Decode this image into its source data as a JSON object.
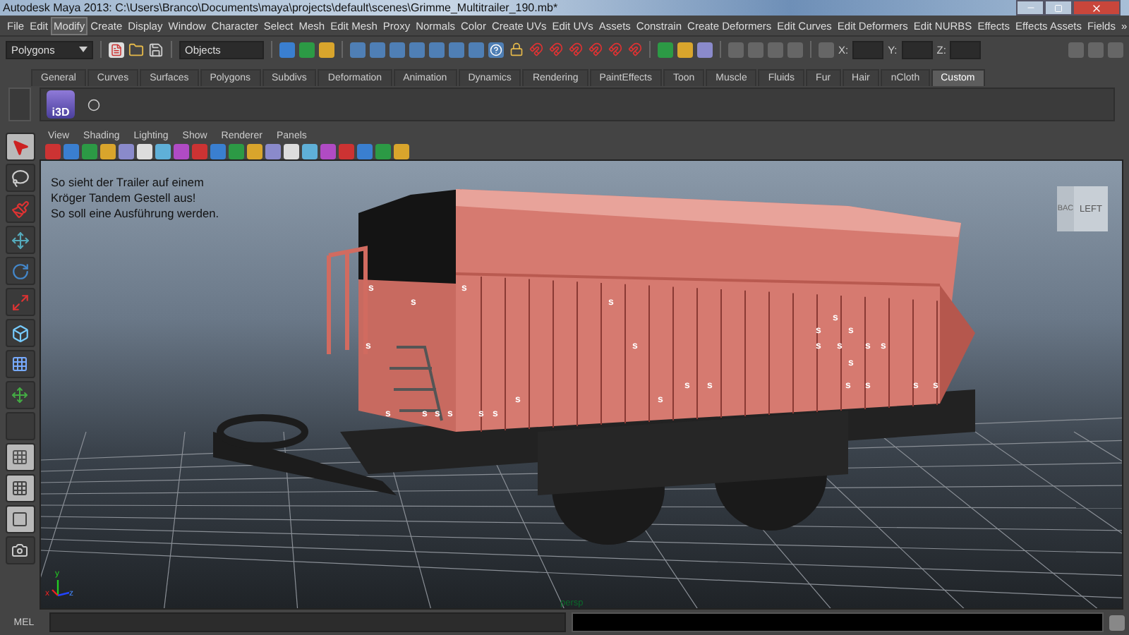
{
  "window": {
    "title": "Autodesk Maya 2013: C:\\Users\\Branco\\Documents\\maya\\projects\\default\\scenes\\Grimme_Multitrailer_190.mb*"
  },
  "menu_bar": [
    {
      "label": "File",
      "hovered": false
    },
    {
      "label": "Edit",
      "hovered": false
    },
    {
      "label": "Modify",
      "hovered": true
    },
    {
      "label": "Create",
      "hovered": false
    },
    {
      "label": "Display",
      "hovered": false
    },
    {
      "label": "Window",
      "hovered": false
    },
    {
      "label": "Character",
      "hovered": false
    },
    {
      "label": "Select",
      "hovered": false
    },
    {
      "label": "Mesh",
      "hovered": false
    },
    {
      "label": "Edit Mesh",
      "hovered": false
    },
    {
      "label": "Proxy",
      "hovered": false
    },
    {
      "label": "Normals",
      "hovered": false
    },
    {
      "label": "Color",
      "hovered": false
    },
    {
      "label": "Create UVs",
      "hovered": false
    },
    {
      "label": "Edit UVs",
      "hovered": false
    },
    {
      "label": "Assets",
      "hovered": false
    },
    {
      "label": "Constrain",
      "hovered": false
    },
    {
      "label": "Create Deformers",
      "hovered": false
    },
    {
      "label": "Edit Curves",
      "hovered": false
    },
    {
      "label": "Edit Deformers",
      "hovered": false
    },
    {
      "label": "Edit NURBS",
      "hovered": false
    },
    {
      "label": "Effects",
      "hovered": false
    },
    {
      "label": "Effects Assets",
      "hovered": false
    },
    {
      "label": "Fields",
      "hovered": false
    }
  ],
  "menu_overflow": "»",
  "status_line": {
    "mode": "Polygons",
    "selection_field": "Objects",
    "x_label": "X:",
    "y_label": "Y:",
    "z_label": "Z:"
  },
  "shelf": {
    "tabs": [
      {
        "label": "General",
        "selected": false
      },
      {
        "label": "Curves",
        "selected": false
      },
      {
        "label": "Surfaces",
        "selected": false
      },
      {
        "label": "Polygons",
        "selected": false
      },
      {
        "label": "Subdivs",
        "selected": false
      },
      {
        "label": "Deformation",
        "selected": false
      },
      {
        "label": "Animation",
        "selected": false
      },
      {
        "label": "Dynamics",
        "selected": false
      },
      {
        "label": "Rendering",
        "selected": false
      },
      {
        "label": "PaintEffects",
        "selected": false
      },
      {
        "label": "Toon",
        "selected": false
      },
      {
        "label": "Muscle",
        "selected": false
      },
      {
        "label": "Fluids",
        "selected": false
      },
      {
        "label": "Fur",
        "selected": false
      },
      {
        "label": "Hair",
        "selected": false
      },
      {
        "label": "nCloth",
        "selected": false
      },
      {
        "label": "Custom",
        "selected": true
      }
    ],
    "logo_text": "i3D"
  },
  "panel_menu": [
    "View",
    "Shading",
    "Lighting",
    "Show",
    "Renderer",
    "Panels"
  ],
  "viewport": {
    "note_lines": [
      "So sieht der Trailer auf einem",
      "Kröger Tandem Gestell aus!",
      "So soll eine Ausführung werden."
    ],
    "view_cube": {
      "front": "LEFT",
      "side": "BAC"
    },
    "camera_label": "persp",
    "axis_labels": [
      "x",
      "y",
      "z"
    ],
    "markers": [
      "s",
      "s",
      "s",
      "s",
      "s",
      "s",
      "s",
      "s",
      "s",
      "s",
      "s",
      "s",
      "s",
      "s",
      "s",
      "s",
      "s",
      "s",
      "s",
      "s",
      "s",
      "s",
      "s",
      "s",
      "s",
      "s",
      "s",
      "s"
    ]
  },
  "command_line": {
    "label": "MEL"
  }
}
